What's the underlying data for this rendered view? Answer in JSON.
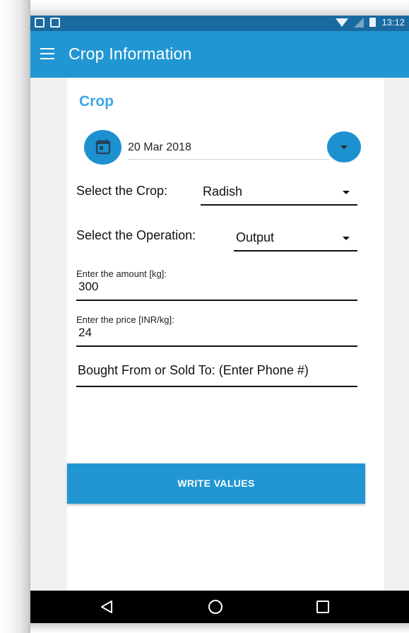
{
  "status_bar": {
    "time": "13:12"
  },
  "app_bar": {
    "title": "Crop Information"
  },
  "form": {
    "section_title": "Crop",
    "date": "20 Mar 2018",
    "crop_label": "Select the Crop:",
    "crop_value": "Radish",
    "operation_label": "Select the Operation:",
    "operation_value": "Output",
    "amount_hint": "Enter the amount [kg]:",
    "amount_value": "300",
    "price_hint": "Enter the price [INR/kg]:",
    "price_value": "24",
    "phone_placeholder": "Bought From or Sold To: (Enter Phone #)",
    "write_button": "WRITE VALUES"
  },
  "colors": {
    "primary": "#2196d3",
    "status_bar": "#1a6aa2",
    "accent_title": "#3aa7e6"
  },
  "icons": [
    "menu-icon",
    "calendar-icon",
    "dropdown-arrow-icon",
    "back-icon",
    "home-icon",
    "recent-apps-icon"
  ]
}
